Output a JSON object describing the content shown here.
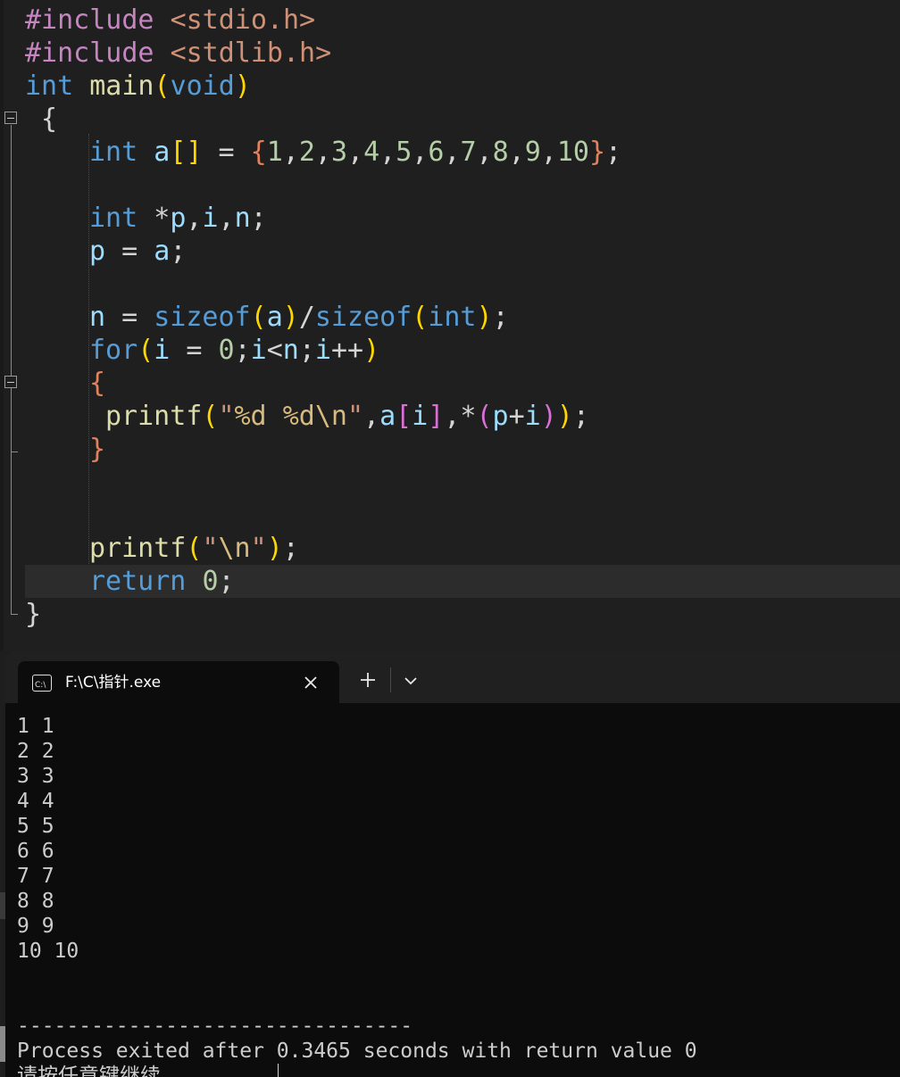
{
  "editor": {
    "lines": [
      "#include <stdio.h>",
      "#include <stdlib.h>",
      "int main(void)",
      "{",
      "int a[] = {1,2,3,4,5,6,7,8,9,10};",
      "",
      "int *p,i,n;",
      "p = a;",
      "",
      "n = sizeof(a)/sizeof(int);",
      "for(i = 0;i<n;i++)",
      "{",
      "printf(\"%d %d\\n\",a[i],*(p+i));",
      "}",
      "",
      "",
      "printf(\"\\n\");",
      "return 0;",
      "}"
    ]
  },
  "terminal": {
    "tab_title": "F:\\C\\指针.exe",
    "icon": "console-app-icon",
    "close_icon": "close-icon",
    "new_tab_icon": "plus-icon",
    "dropdown_icon": "chevron-down-icon",
    "output_lines": [
      "1 1",
      "2 2",
      "3 3",
      "4 4",
      "5 5",
      "6 6",
      "7 7",
      "8 8",
      "9 9",
      "10 10",
      "",
      "",
      "--------------------------------",
      "Process exited after 0.3465 seconds with return value 0",
      "请按任意键继续. . ."
    ]
  }
}
